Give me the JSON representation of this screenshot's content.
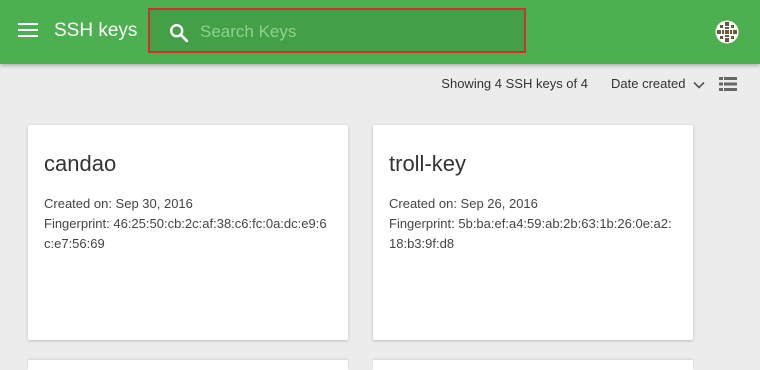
{
  "header": {
    "title": "SSH keys",
    "brand_color": "#4caf50",
    "menu_icon": "hamburger-icon",
    "avatar_icon": "user-avatar-icon"
  },
  "search": {
    "placeholder": "Search Keys",
    "value": "",
    "icon": "search-icon",
    "highlight_color": "#d32f2f"
  },
  "toolbar": {
    "count_text": "Showing 4 SSH keys of 4",
    "sort_label": "Date created",
    "view_icon": "list-view-icon"
  },
  "keys": [
    {
      "name": "candao",
      "created": "Created on: Sep 30, 2016",
      "fingerprint": "Fingerprint: 46:25:50:cb:2c:af:38:c6:fc:0a:dc:e9:6c:e7:56:69"
    },
    {
      "name": "troll-key",
      "created": "Created on: Sep 26, 2016",
      "fingerprint": "Fingerprint: 5b:ba:ef:a4:59:ab:2b:63:1b:26:0e:a2:18:b3:9f:d8"
    }
  ]
}
